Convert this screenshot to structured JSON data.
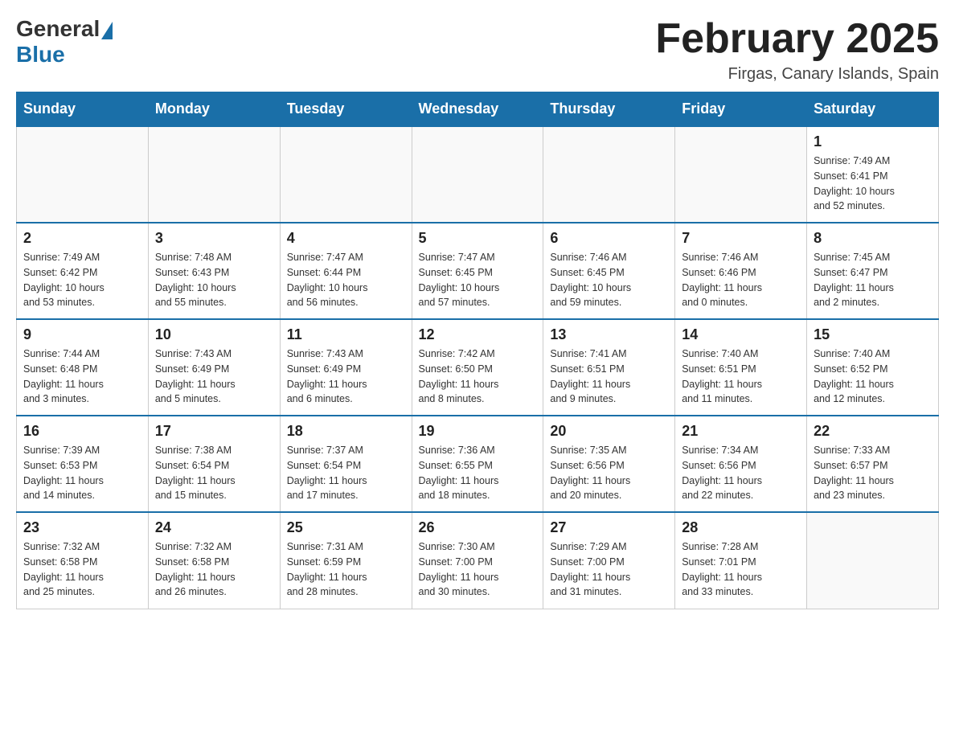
{
  "header": {
    "logo_general": "General",
    "logo_blue": "Blue",
    "month_title": "February 2025",
    "location": "Firgas, Canary Islands, Spain"
  },
  "days_of_week": [
    "Sunday",
    "Monday",
    "Tuesday",
    "Wednesday",
    "Thursday",
    "Friday",
    "Saturday"
  ],
  "weeks": [
    {
      "days": [
        {
          "number": "",
          "info": ""
        },
        {
          "number": "",
          "info": ""
        },
        {
          "number": "",
          "info": ""
        },
        {
          "number": "",
          "info": ""
        },
        {
          "number": "",
          "info": ""
        },
        {
          "number": "",
          "info": ""
        },
        {
          "number": "1",
          "info": "Sunrise: 7:49 AM\nSunset: 6:41 PM\nDaylight: 10 hours\nand 52 minutes."
        }
      ]
    },
    {
      "days": [
        {
          "number": "2",
          "info": "Sunrise: 7:49 AM\nSunset: 6:42 PM\nDaylight: 10 hours\nand 53 minutes."
        },
        {
          "number": "3",
          "info": "Sunrise: 7:48 AM\nSunset: 6:43 PM\nDaylight: 10 hours\nand 55 minutes."
        },
        {
          "number": "4",
          "info": "Sunrise: 7:47 AM\nSunset: 6:44 PM\nDaylight: 10 hours\nand 56 minutes."
        },
        {
          "number": "5",
          "info": "Sunrise: 7:47 AM\nSunset: 6:45 PM\nDaylight: 10 hours\nand 57 minutes."
        },
        {
          "number": "6",
          "info": "Sunrise: 7:46 AM\nSunset: 6:45 PM\nDaylight: 10 hours\nand 59 minutes."
        },
        {
          "number": "7",
          "info": "Sunrise: 7:46 AM\nSunset: 6:46 PM\nDaylight: 11 hours\nand 0 minutes."
        },
        {
          "number": "8",
          "info": "Sunrise: 7:45 AM\nSunset: 6:47 PM\nDaylight: 11 hours\nand 2 minutes."
        }
      ]
    },
    {
      "days": [
        {
          "number": "9",
          "info": "Sunrise: 7:44 AM\nSunset: 6:48 PM\nDaylight: 11 hours\nand 3 minutes."
        },
        {
          "number": "10",
          "info": "Sunrise: 7:43 AM\nSunset: 6:49 PM\nDaylight: 11 hours\nand 5 minutes."
        },
        {
          "number": "11",
          "info": "Sunrise: 7:43 AM\nSunset: 6:49 PM\nDaylight: 11 hours\nand 6 minutes."
        },
        {
          "number": "12",
          "info": "Sunrise: 7:42 AM\nSunset: 6:50 PM\nDaylight: 11 hours\nand 8 minutes."
        },
        {
          "number": "13",
          "info": "Sunrise: 7:41 AM\nSunset: 6:51 PM\nDaylight: 11 hours\nand 9 minutes."
        },
        {
          "number": "14",
          "info": "Sunrise: 7:40 AM\nSunset: 6:51 PM\nDaylight: 11 hours\nand 11 minutes."
        },
        {
          "number": "15",
          "info": "Sunrise: 7:40 AM\nSunset: 6:52 PM\nDaylight: 11 hours\nand 12 minutes."
        }
      ]
    },
    {
      "days": [
        {
          "number": "16",
          "info": "Sunrise: 7:39 AM\nSunset: 6:53 PM\nDaylight: 11 hours\nand 14 minutes."
        },
        {
          "number": "17",
          "info": "Sunrise: 7:38 AM\nSunset: 6:54 PM\nDaylight: 11 hours\nand 15 minutes."
        },
        {
          "number": "18",
          "info": "Sunrise: 7:37 AM\nSunset: 6:54 PM\nDaylight: 11 hours\nand 17 minutes."
        },
        {
          "number": "19",
          "info": "Sunrise: 7:36 AM\nSunset: 6:55 PM\nDaylight: 11 hours\nand 18 minutes."
        },
        {
          "number": "20",
          "info": "Sunrise: 7:35 AM\nSunset: 6:56 PM\nDaylight: 11 hours\nand 20 minutes."
        },
        {
          "number": "21",
          "info": "Sunrise: 7:34 AM\nSunset: 6:56 PM\nDaylight: 11 hours\nand 22 minutes."
        },
        {
          "number": "22",
          "info": "Sunrise: 7:33 AM\nSunset: 6:57 PM\nDaylight: 11 hours\nand 23 minutes."
        }
      ]
    },
    {
      "days": [
        {
          "number": "23",
          "info": "Sunrise: 7:32 AM\nSunset: 6:58 PM\nDaylight: 11 hours\nand 25 minutes."
        },
        {
          "number": "24",
          "info": "Sunrise: 7:32 AM\nSunset: 6:58 PM\nDaylight: 11 hours\nand 26 minutes."
        },
        {
          "number": "25",
          "info": "Sunrise: 7:31 AM\nSunset: 6:59 PM\nDaylight: 11 hours\nand 28 minutes."
        },
        {
          "number": "26",
          "info": "Sunrise: 7:30 AM\nSunset: 7:00 PM\nDaylight: 11 hours\nand 30 minutes."
        },
        {
          "number": "27",
          "info": "Sunrise: 7:29 AM\nSunset: 7:00 PM\nDaylight: 11 hours\nand 31 minutes."
        },
        {
          "number": "28",
          "info": "Sunrise: 7:28 AM\nSunset: 7:01 PM\nDaylight: 11 hours\nand 33 minutes."
        },
        {
          "number": "",
          "info": ""
        }
      ]
    }
  ]
}
